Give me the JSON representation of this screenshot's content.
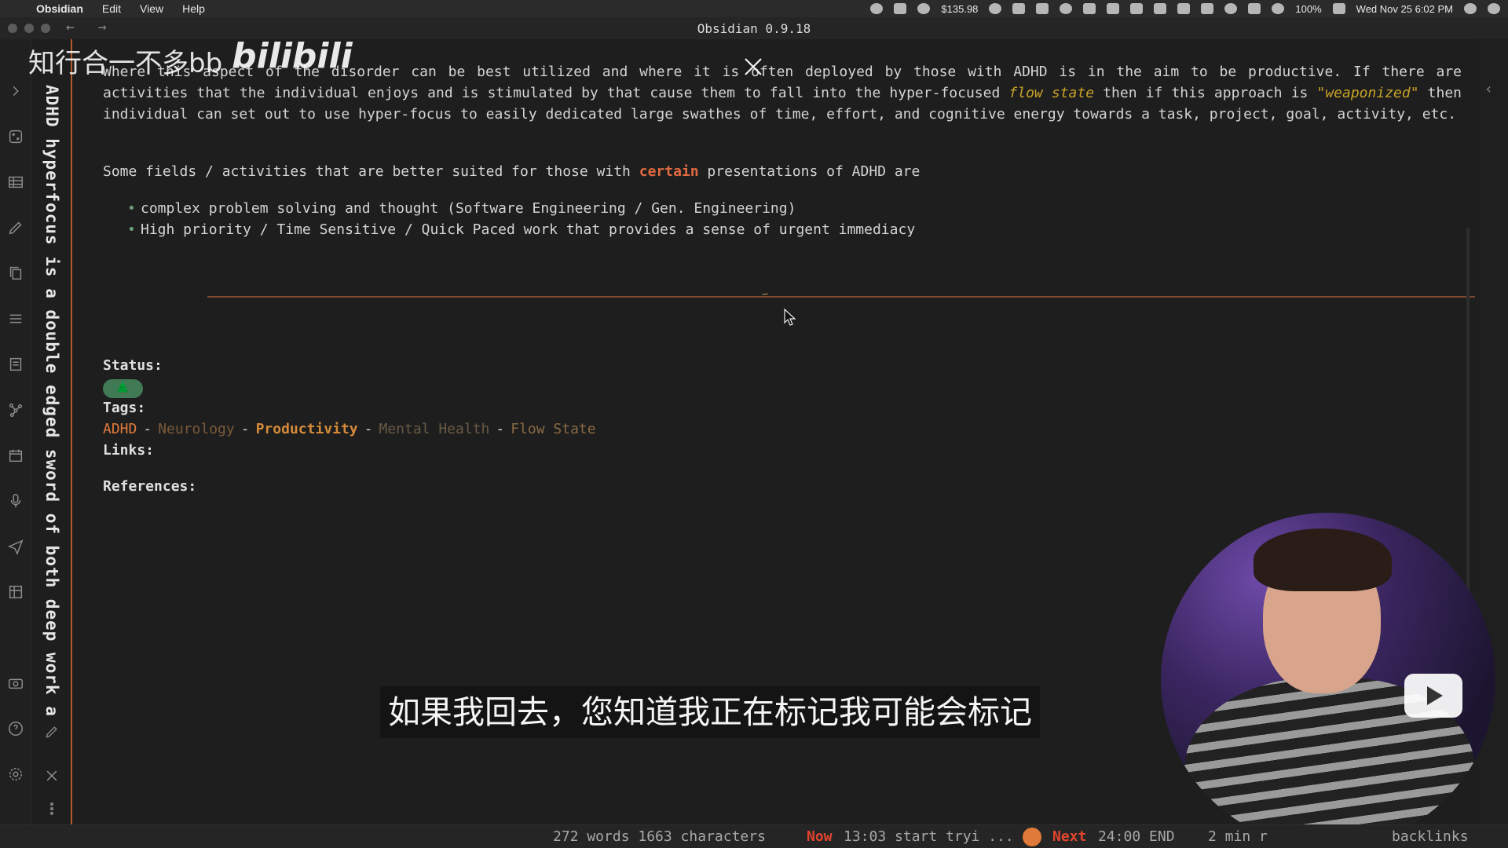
{
  "menubar": {
    "app": "Obsidian",
    "menus": [
      "Edit",
      "View",
      "Help"
    ],
    "money": "$135.98",
    "battery": "100%",
    "datetime": "Wed Nov 25  6:02 PM"
  },
  "window": {
    "title": "Obsidian 0.9.18",
    "back": "←",
    "forward": "→"
  },
  "note": {
    "vertical_title": "ADHD hyperfocus is a double edged sword of both deep work a",
    "para1_a": "Where this aspect of the disorder can be best utilized and where it is often deployed by those with ADHD is in the aim to be productive. If there are activities that the individual enjoys and is stimulated by that cause them to fall into the hyper-focused ",
    "para1_flow": "flow state",
    "para1_b": " then if this approach is ",
    "para1_weapon": "\"weaponized\"",
    "para1_c": " then individual can set out to use hyper-focus to easily dedicated large swathes of time, effort, and cognitive energy towards a task, project, goal, activity, etc.",
    "para2_a": "Some fields / activities that are better suited for those with ",
    "para2_certain": "certain",
    "para2_b": " presentations of ADHD are",
    "bullets": [
      "complex problem solving and thought (Software Engineering / Gen. Engineering)",
      "High priority / Time Sensitive / Quick Paced work that provides a sense of urgent immediacy"
    ],
    "status_label": "Status:",
    "status_emoji": "🌲",
    "tags_label": "Tags:",
    "tags": [
      "ADHD",
      "Neurology",
      "Productivity",
      "Mental Health",
      "Flow State"
    ],
    "tag_sep": "-",
    "links_label": "Links:",
    "references_label": "References:"
  },
  "overlay": {
    "watermark_text": "知行合一不多bb",
    "watermark_logo": "bilibili",
    "subtitle": "如果我回去，您知道我正在标记我可能会标记"
  },
  "statusbar": {
    "counts": "272 words 1663 characters",
    "now_label": "Now",
    "now_text": "13:03 start tryi ...",
    "next_label": "Next",
    "next_text": "24:00 END",
    "read_time": "2 min r",
    "backlinks": "backlinks"
  },
  "colors": {
    "accent": "#e26a43",
    "status_pill": "#3f7a55",
    "border_accent": "#b55a2a"
  }
}
